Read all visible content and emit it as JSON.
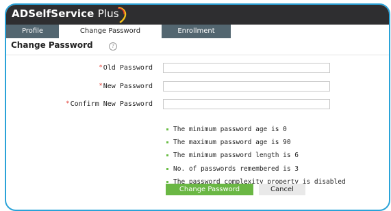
{
  "app": {
    "name": "ADSelfService",
    "name_suffix": "Plus"
  },
  "tabs": [
    {
      "label": "Profile",
      "active": false
    },
    {
      "label": "Change Password",
      "active": true
    },
    {
      "label": "Enrollment",
      "active": false
    }
  ],
  "page": {
    "title": "Change Password",
    "help_glyph": "?"
  },
  "form": {
    "required_marker": "*",
    "fields": [
      {
        "label": "Old Password",
        "value": "",
        "placeholder": ""
      },
      {
        "label": "New Password",
        "value": "",
        "placeholder": ""
      },
      {
        "label": "Confirm New Password",
        "value": "",
        "placeholder": ""
      }
    ]
  },
  "policy_rules": [
    "The minimum password age is 0",
    "The maximum password age is 90",
    "The minimum password length is 6",
    "No. of passwords remembered is 3",
    "The password complexity property is disabled"
  ],
  "buttons": {
    "submit": "Change Password",
    "cancel": "Cancel"
  },
  "colors": {
    "frame_border": "#2aa3d8",
    "topbar": "#2e2e30",
    "tab_inactive": "#536670",
    "accent_green": "#6ab744",
    "required_red": "#e0322a"
  }
}
